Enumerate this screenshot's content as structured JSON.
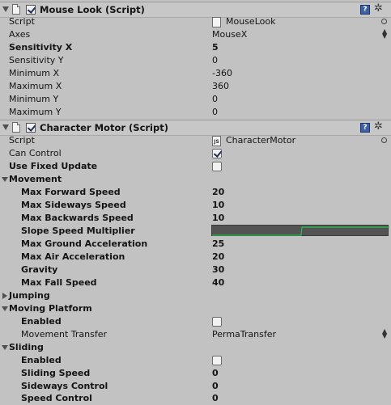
{
  "mouse_look": {
    "title": "Mouse Look (Script)",
    "rows": {
      "script_label": "Script",
      "script_value": "MouseLook",
      "axes_label": "Axes",
      "axes_value": "MouseX",
      "sensx_label": "Sensitivity X",
      "sensx_value": "5",
      "sensy_label": "Sensitivity Y",
      "sensy_value": "0",
      "minx_label": "Minimum X",
      "minx_value": "-360",
      "maxx_label": "Maximum X",
      "maxx_value": "360",
      "miny_label": "Minimum Y",
      "miny_value": "0",
      "maxy_label": "Maximum Y",
      "maxy_value": "0"
    }
  },
  "character_motor": {
    "title": "Character Motor (Script)",
    "script_label": "Script",
    "script_value": "CharacterMotor",
    "can_control_label": "Can Control",
    "can_control": true,
    "fixed_update_label": "Use Fixed Update",
    "fixed_update": false,
    "movement": {
      "label": "Movement",
      "max_forward_label": "Max Forward Speed",
      "max_forward": "20",
      "max_sideways_label": "Max Sideways Speed",
      "max_sideways": "10",
      "max_backwards_label": "Max Backwards Speed",
      "max_backwards": "10",
      "slope_label": "Slope Speed Multiplier",
      "ground_accel_label": "Max Ground Acceleration",
      "ground_accel": "25",
      "air_accel_label": "Max Air Acceleration",
      "air_accel": "20",
      "gravity_label": "Gravity",
      "gravity": "30",
      "fall_speed_label": "Max Fall Speed",
      "fall_speed": "40"
    },
    "jumping": {
      "label": "Jumping"
    },
    "moving_platform": {
      "label": "Moving Platform",
      "enabled_label": "Enabled",
      "enabled": false,
      "transfer_label": "Movement Transfer",
      "transfer_value": "PermaTransfer"
    },
    "sliding": {
      "label": "Sliding",
      "enabled_label": "Enabled",
      "enabled": false,
      "sliding_speed_label": "Sliding Speed",
      "sliding_speed": "0",
      "sideways_control_label": "Sideways Control",
      "sideways_control": "0",
      "speed_control_label": "Speed Control",
      "speed_control": "0"
    }
  },
  "colors": {
    "curve_line": "#22c24a",
    "help_icon": "#3b62a8"
  },
  "icons": {
    "script_icon_text": "JS"
  }
}
